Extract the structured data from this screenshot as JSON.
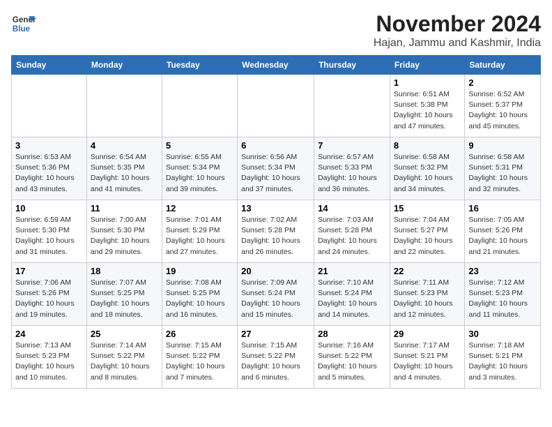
{
  "header": {
    "logo_line1": "General",
    "logo_line2": "Blue",
    "month": "November 2024",
    "location": "Hajan, Jammu and Kashmir, India"
  },
  "weekdays": [
    "Sunday",
    "Monday",
    "Tuesday",
    "Wednesday",
    "Thursday",
    "Friday",
    "Saturday"
  ],
  "weeks": [
    [
      {
        "day": "",
        "info": ""
      },
      {
        "day": "",
        "info": ""
      },
      {
        "day": "",
        "info": ""
      },
      {
        "day": "",
        "info": ""
      },
      {
        "day": "",
        "info": ""
      },
      {
        "day": "1",
        "info": "Sunrise: 6:51 AM\nSunset: 5:38 PM\nDaylight: 10 hours\nand 47 minutes."
      },
      {
        "day": "2",
        "info": "Sunrise: 6:52 AM\nSunset: 5:37 PM\nDaylight: 10 hours\nand 45 minutes."
      }
    ],
    [
      {
        "day": "3",
        "info": "Sunrise: 6:53 AM\nSunset: 5:36 PM\nDaylight: 10 hours\nand 43 minutes."
      },
      {
        "day": "4",
        "info": "Sunrise: 6:54 AM\nSunset: 5:35 PM\nDaylight: 10 hours\nand 41 minutes."
      },
      {
        "day": "5",
        "info": "Sunrise: 6:55 AM\nSunset: 5:34 PM\nDaylight: 10 hours\nand 39 minutes."
      },
      {
        "day": "6",
        "info": "Sunrise: 6:56 AM\nSunset: 5:34 PM\nDaylight: 10 hours\nand 37 minutes."
      },
      {
        "day": "7",
        "info": "Sunrise: 6:57 AM\nSunset: 5:33 PM\nDaylight: 10 hours\nand 36 minutes."
      },
      {
        "day": "8",
        "info": "Sunrise: 6:58 AM\nSunset: 5:32 PM\nDaylight: 10 hours\nand 34 minutes."
      },
      {
        "day": "9",
        "info": "Sunrise: 6:58 AM\nSunset: 5:31 PM\nDaylight: 10 hours\nand 32 minutes."
      }
    ],
    [
      {
        "day": "10",
        "info": "Sunrise: 6:59 AM\nSunset: 5:30 PM\nDaylight: 10 hours\nand 31 minutes."
      },
      {
        "day": "11",
        "info": "Sunrise: 7:00 AM\nSunset: 5:30 PM\nDaylight: 10 hours\nand 29 minutes."
      },
      {
        "day": "12",
        "info": "Sunrise: 7:01 AM\nSunset: 5:29 PM\nDaylight: 10 hours\nand 27 minutes."
      },
      {
        "day": "13",
        "info": "Sunrise: 7:02 AM\nSunset: 5:28 PM\nDaylight: 10 hours\nand 26 minutes."
      },
      {
        "day": "14",
        "info": "Sunrise: 7:03 AM\nSunset: 5:28 PM\nDaylight: 10 hours\nand 24 minutes."
      },
      {
        "day": "15",
        "info": "Sunrise: 7:04 AM\nSunset: 5:27 PM\nDaylight: 10 hours\nand 22 minutes."
      },
      {
        "day": "16",
        "info": "Sunrise: 7:05 AM\nSunset: 5:26 PM\nDaylight: 10 hours\nand 21 minutes."
      }
    ],
    [
      {
        "day": "17",
        "info": "Sunrise: 7:06 AM\nSunset: 5:26 PM\nDaylight: 10 hours\nand 19 minutes."
      },
      {
        "day": "18",
        "info": "Sunrise: 7:07 AM\nSunset: 5:25 PM\nDaylight: 10 hours\nand 18 minutes."
      },
      {
        "day": "19",
        "info": "Sunrise: 7:08 AM\nSunset: 5:25 PM\nDaylight: 10 hours\nand 16 minutes."
      },
      {
        "day": "20",
        "info": "Sunrise: 7:09 AM\nSunset: 5:24 PM\nDaylight: 10 hours\nand 15 minutes."
      },
      {
        "day": "21",
        "info": "Sunrise: 7:10 AM\nSunset: 5:24 PM\nDaylight: 10 hours\nand 14 minutes."
      },
      {
        "day": "22",
        "info": "Sunrise: 7:11 AM\nSunset: 5:23 PM\nDaylight: 10 hours\nand 12 minutes."
      },
      {
        "day": "23",
        "info": "Sunrise: 7:12 AM\nSunset: 5:23 PM\nDaylight: 10 hours\nand 11 minutes."
      }
    ],
    [
      {
        "day": "24",
        "info": "Sunrise: 7:13 AM\nSunset: 5:23 PM\nDaylight: 10 hours\nand 10 minutes."
      },
      {
        "day": "25",
        "info": "Sunrise: 7:14 AM\nSunset: 5:22 PM\nDaylight: 10 hours\nand 8 minutes."
      },
      {
        "day": "26",
        "info": "Sunrise: 7:15 AM\nSunset: 5:22 PM\nDaylight: 10 hours\nand 7 minutes."
      },
      {
        "day": "27",
        "info": "Sunrise: 7:15 AM\nSunset: 5:22 PM\nDaylight: 10 hours\nand 6 minutes."
      },
      {
        "day": "28",
        "info": "Sunrise: 7:16 AM\nSunset: 5:22 PM\nDaylight: 10 hours\nand 5 minutes."
      },
      {
        "day": "29",
        "info": "Sunrise: 7:17 AM\nSunset: 5:21 PM\nDaylight: 10 hours\nand 4 minutes."
      },
      {
        "day": "30",
        "info": "Sunrise: 7:18 AM\nSunset: 5:21 PM\nDaylight: 10 hours\nand 3 minutes."
      }
    ]
  ]
}
